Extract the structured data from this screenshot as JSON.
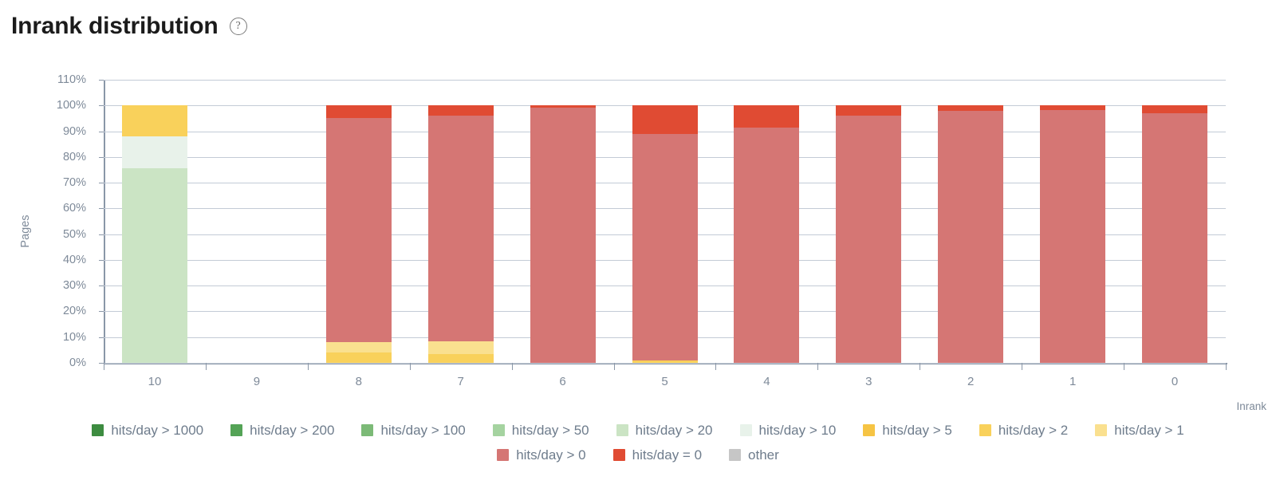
{
  "header": {
    "title": "Inrank distribution",
    "help_icon": "question-mark-circle-icon",
    "help_tooltip": "?"
  },
  "chart_data": {
    "type": "bar",
    "stacked": true,
    "title": "Inrank distribution",
    "xlabel": "Inrank",
    "ylabel": "Pages",
    "ylim": [
      0,
      110
    ],
    "ytick_labels": [
      "0%",
      "10%",
      "20%",
      "30%",
      "40%",
      "50%",
      "60%",
      "70%",
      "80%",
      "90%",
      "100%",
      "110%"
    ],
    "ytick_values": [
      0,
      10,
      20,
      30,
      40,
      50,
      60,
      70,
      80,
      90,
      100,
      110
    ],
    "grid": true,
    "legend_position": "bottom",
    "categories": [
      "10",
      "9",
      "8",
      "7",
      "6",
      "5",
      "4",
      "3",
      "2",
      "1",
      "0"
    ],
    "series": [
      {
        "name": "hits/day > 1000",
        "color": "#3d8c40",
        "values": [
          0,
          0,
          0,
          0,
          0,
          0,
          0,
          0,
          0,
          0,
          0
        ]
      },
      {
        "name": "hits/day > 200",
        "color": "#54a css",
        "values": [
          0,
          0,
          0,
          0,
          0,
          0,
          0,
          0,
          0,
          0,
          0
        ]
      },
      {
        "name": "hits/day > 100",
        "color": "#7cba77",
        "values": [
          0,
          0,
          0,
          0,
          0,
          0,
          0,
          0,
          0,
          0,
          0
        ]
      },
      {
        "name": "hits/day > 50",
        "color": "#a5d3a0",
        "values": [
          0,
          0,
          0,
          0,
          0,
          0,
          0,
          0,
          0,
          0,
          0
        ]
      },
      {
        "name": "hits/day > 20",
        "color": "#cbe4c4",
        "values": [
          75.5,
          0,
          0,
          0,
          0,
          0,
          0,
          0,
          0,
          0,
          0
        ]
      },
      {
        "name": "hits/day > 10",
        "color": "#e8f2ea",
        "values": [
          12.5,
          0,
          0,
          0,
          0,
          0,
          0,
          0,
          0,
          0,
          0
        ]
      },
      {
        "name": "hits/day > 5",
        "color": "#f6c444",
        "values": [
          0,
          0,
          0,
          0,
          0,
          0,
          0,
          0,
          0,
          0,
          0
        ]
      },
      {
        "name": "hits/day > 2",
        "color": "#f9d15b",
        "values": [
          12.0,
          0,
          4.0,
          3.5,
          0,
          1.0,
          0,
          0,
          0,
          0,
          0
        ]
      },
      {
        "name": "hits/day > 1",
        "color": "#fae08f",
        "values": [
          0,
          0,
          4.0,
          5.0,
          0,
          0,
          0,
          0,
          0,
          0,
          0
        ]
      },
      {
        "name": "hits/day > 0",
        "color": "#d57674",
        "values": [
          0,
          0,
          87.0,
          87.5,
          99.2,
          88.0,
          91.5,
          96.0,
          98.0,
          98.2,
          97.0
        ]
      },
      {
        "name": "hits/day = 0",
        "color": "#e04b33",
        "values": [
          0,
          0,
          5.0,
          4.0,
          0.8,
          11.0,
          8.5,
          4.0,
          2.0,
          1.8,
          3.0
        ]
      },
      {
        "name": "other",
        "color": "#c6c6c6",
        "values": [
          0,
          0,
          0,
          0,
          0,
          0,
          0,
          0,
          0,
          0,
          0
        ]
      }
    ]
  },
  "legend": {
    "rows": [
      [
        {
          "label": "hits/day > 1000",
          "color": "#3d8c40"
        },
        {
          "label": "hits/day > 200",
          "color": "#54a356"
        },
        {
          "label": "hits/day > 100",
          "color": "#7cba77"
        },
        {
          "label": "hits/day > 50",
          "color": "#a5d3a0"
        },
        {
          "label": "hits/day > 20",
          "color": "#cbe4c4"
        },
        {
          "label": "hits/day > 10",
          "color": "#e8f2ea"
        },
        {
          "label": "hits/day > 5",
          "color": "#f6c444"
        },
        {
          "label": "hits/day > 2",
          "color": "#f9d15b"
        },
        {
          "label": "hits/day > 1",
          "color": "#fae08f"
        }
      ],
      [
        {
          "label": "hits/day > 0",
          "color": "#d57674"
        },
        {
          "label": "hits/day = 0",
          "color": "#e04b33"
        },
        {
          "label": "other",
          "color": "#c6c6c6"
        }
      ]
    ]
  }
}
